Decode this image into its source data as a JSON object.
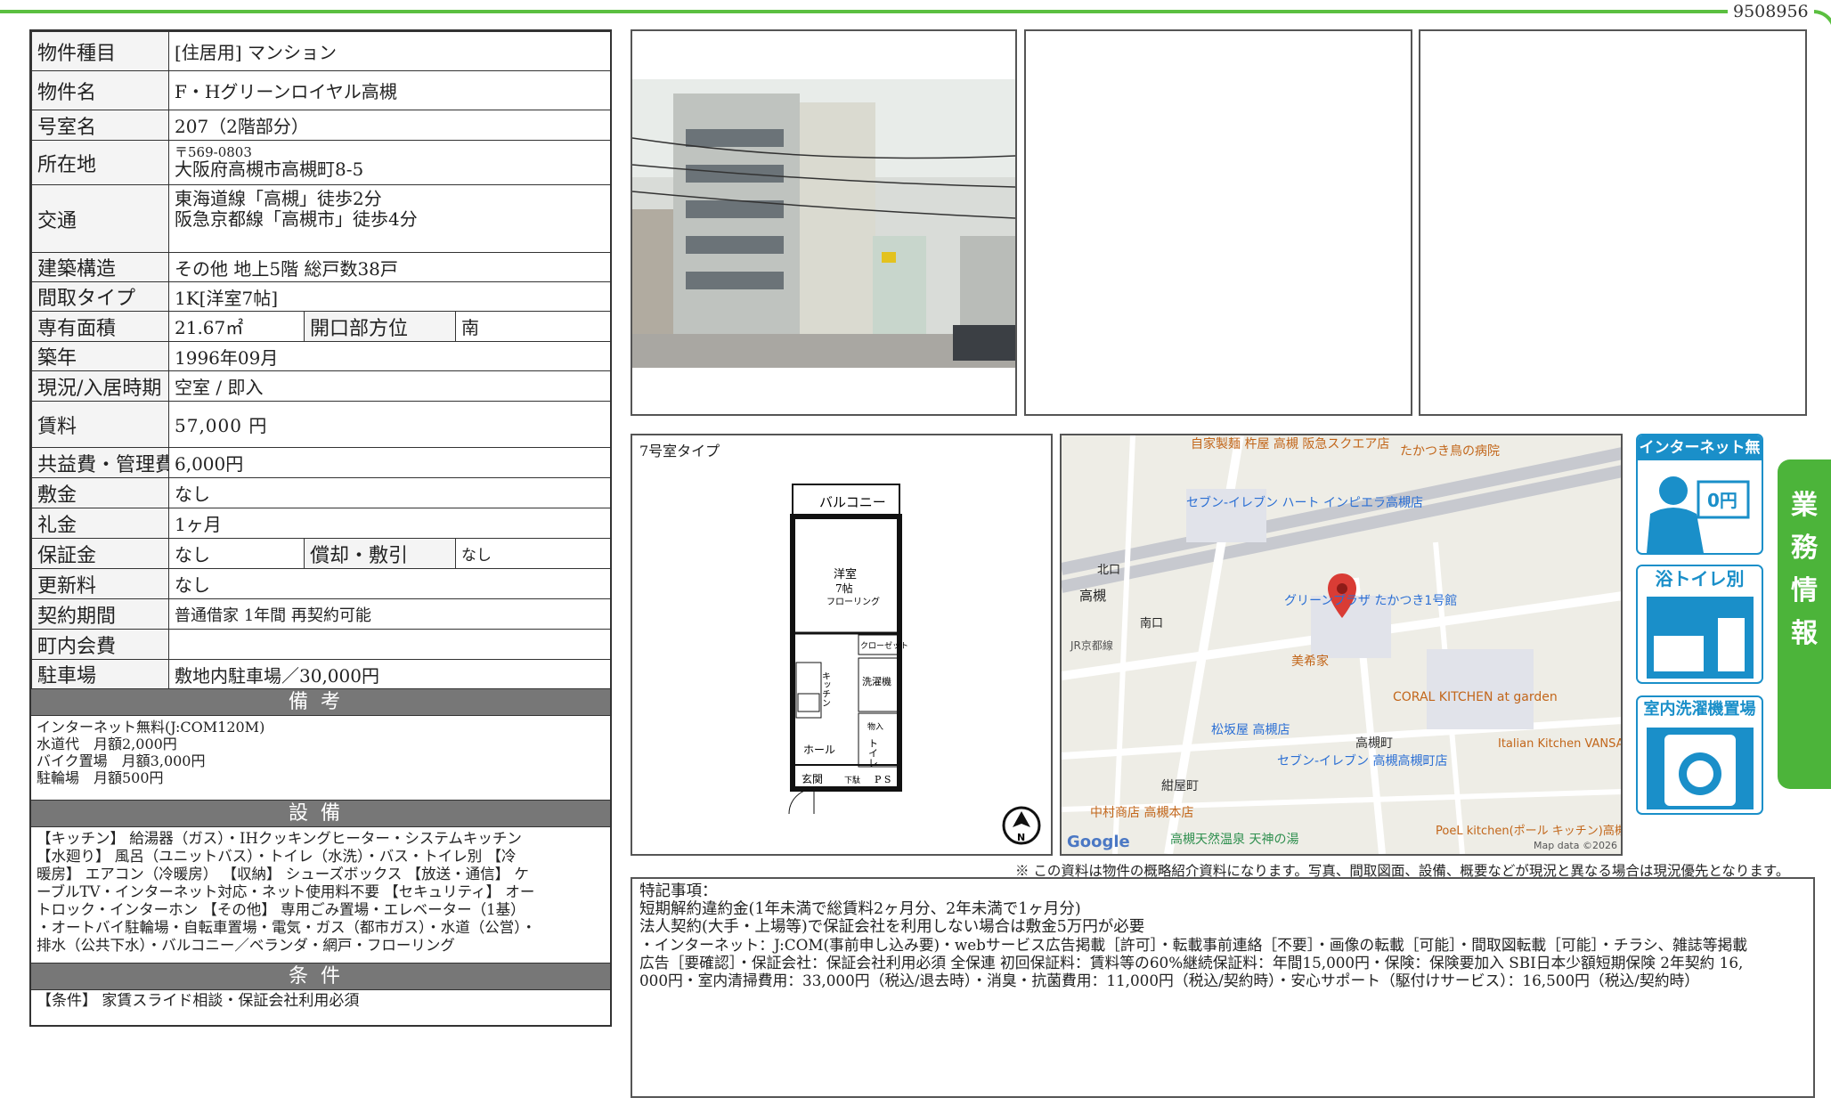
{
  "doc_id": "9508956",
  "spec": {
    "type_label": "物件種目",
    "type_value": "[住居用] マンション",
    "name_label": "物件名",
    "name_value": "F・Hグリーンロイヤル高槻",
    "room_label": "号室名",
    "room_value": "207（2階部分）",
    "address_label": "所在地",
    "postal": "〒569-0803",
    "address": "大阪府高槻市高槻町8-5",
    "access_label": "交通",
    "access_1": "東海道線「高槻」徒歩2分",
    "access_2": "阪急京都線「高槻市」徒歩4分",
    "structure_label": "建築構造",
    "structure_value": "その他 地上5階 総戸数38戸",
    "layout_label": "間取タイプ",
    "layout_value": "1K[洋室7帖]",
    "area_label": "専有面積",
    "area_value": "21.67㎡",
    "direction_label": "開口部方位",
    "direction_value": "南",
    "built_label": "築年",
    "built_value": "1996年09月",
    "status_label": "現況/入居時期",
    "status_value": "空室 / 即入",
    "rent_label": "賃料",
    "rent_value": "57,000 円",
    "fee_label": "共益費・管理費",
    "fee_value": "6,000円",
    "deposit_label": "敷金",
    "deposit_value": "なし",
    "key_money_label": "礼金",
    "key_money_value": "1ヶ月",
    "guarantee_label": "保証金",
    "guarantee_value": "なし",
    "amort_label": "償却・敷引",
    "amort_value": "なし",
    "renewal_label": "更新料",
    "renewal_value": "なし",
    "contract_label": "契約期間",
    "contract_value": "普通借家 1年間 再契約可能",
    "town_label": "町内会費",
    "town_value": "",
    "parking_label": "駐車場",
    "parking_value": "敷地内駐車場／30,000円"
  },
  "bikou": {
    "header": "備考",
    "lines": [
      "インターネット無料(J:COM120M)",
      "水道代　月額2,000円",
      "バイク置場　月額3,000円",
      "駐輪場　月額500円"
    ]
  },
  "setsubi": {
    "header": "設備",
    "lines": [
      "【キッチン】 給湯器（ガス）・IHクッキングヒーター・システムキッチン",
      "【水廻り】 風呂（ユニットバス）・トイレ（水洗）・バス・トイレ別 【冷",
      "暖房】 エアコン（冷暖房） 【収納】 シューズボックス 【放送・通信】 ケ",
      "ーブルTV・インターネット対応・ネット使用料不要 【セキュリティ】 オー",
      "トロック・インターホン 【その他】 専用ごみ置場・エレベーター（1基）",
      "・オートバイ駐輪場・自転車置場・電気・ガス（都市ガス）・水道（公営）・",
      "排水（公共下水）・バルコニー／ベランダ・網戸・フローリング"
    ]
  },
  "jouken": {
    "header": "条件",
    "text": "【条件】 家賃スライド相談・保証会社利用必須"
  },
  "floorplan": {
    "label": "7号室タイプ",
    "balcony": "バルコニー",
    "room": "洋室",
    "room_size": "7帖",
    "floor": "フローリング",
    "closet": "クローゼット",
    "kitchen": "キッチン",
    "washer": "洗濯機",
    "hall": "ホール",
    "toilet": "トイレ",
    "entry": "玄関",
    "shoe": "下駄",
    "ps": "P S",
    "storage": "物入"
  },
  "map": {
    "labels": [
      "自家製麺 杵屋 高槻 阪急スクエア店",
      "たかつき鳥の病院",
      "セブン-イレブン ハート インピエラ高槻店",
      "北口",
      "高槻",
      "JR京都線",
      "南口",
      "グリーンプラザ たかつき1号館",
      "美希家",
      "CORAL KITCHEN at garden",
      "松坂屋 高槻店",
      "高槻町",
      "Italian Kitchen VANSAN 高槻店",
      "セブン-イレブン 高槻高槻町店",
      "紺屋町",
      "中村商店 高槻本店",
      "高槻天然温泉 天神の湯",
      "PoeL kitchen(ポール キッチン)高槻"
    ],
    "google": "Google",
    "map_data": "Map data ©2026"
  },
  "badges": [
    "インターネット無料",
    "浴トイレ別",
    "室内洗濯機置場"
  ],
  "badge_zero": "0円",
  "side_tab": [
    "業",
    "務",
    "情",
    "報"
  ],
  "disclaimer": "※ この資料は物件の概略紹介資料になります。写真、間取図面、設備、概要などが現況と異なる場合は現況優先となります。",
  "remarks": [
    "特記事項：",
    "短期解約違約金(1年未満で総賃料2ヶ月分、2年未満で1ヶ月分)",
    "法人契約(大手・上場等)で保証会社を利用しない場合は敷金5万円が必要",
    "・インターネット：J:COM(事前申し込み要)・webサービス広告掲載［許可］・転載事前連絡［不要］・画像の転載［可能］・間取図転載［可能］・チラシ、雑誌等掲載",
    "広告［要確認］・保証会社：保証会社利用必須 全保連 初回保証料：賃料等の60%継続保証料：年間15,000円・保険：保険要加入 SBI日本少額短期保険 2年契約 16,",
    "000円・室内清掃費用：33,000円（税込/退去時）・消臭・抗菌費用：11,000円（税込/契約時）・安心サポート（駆付けサービス）：16,500円（税込/契約時）"
  ]
}
